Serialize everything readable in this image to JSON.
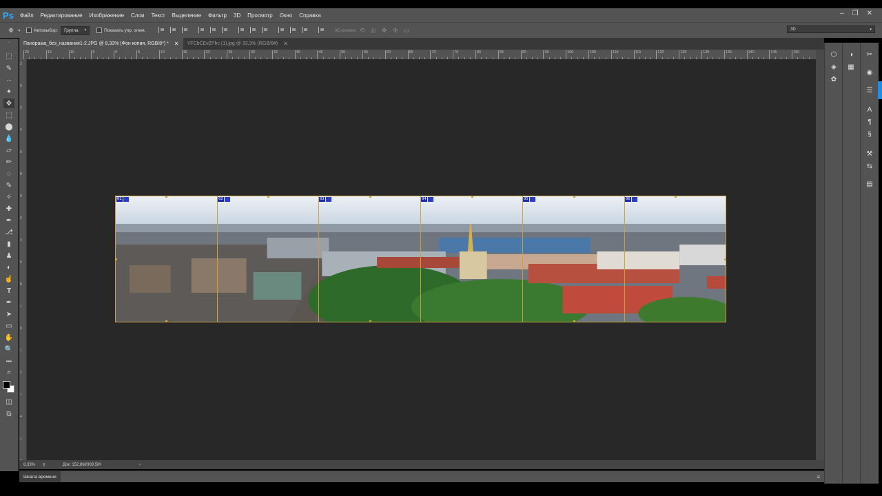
{
  "app": {
    "logo": "Ps"
  },
  "menu": [
    "Файл",
    "Редактирование",
    "Изображение",
    "Слои",
    "Текст",
    "Выделение",
    "Фильтр",
    "3D",
    "Просмотр",
    "Окно",
    "Справка"
  ],
  "window_controls": {
    "minimize": "–",
    "restore": "❐",
    "close": "✕"
  },
  "options": {
    "autoselect_label": "Автовыбор:",
    "autoselect_value": "Группа",
    "show_controls_label": "Показать упр. элем.",
    "mode_3d_label": "3D-режим:",
    "workspace_value": "3D"
  },
  "tabs": [
    {
      "title": "Панорама_без_названия1-2.JPG @ 8,33% (Фон копия, RGB/8*) *",
      "close": "✕"
    },
    {
      "title": "YFCbCEvZPhc (1).jpg @ 33,3% (RGB/8#)",
      "close": "✕"
    }
  ],
  "ruler_top": [
    "20",
    "15",
    "10",
    "5",
    "0",
    "5",
    "10",
    "15",
    "20",
    "25",
    "30",
    "35",
    "40",
    "45",
    "50",
    "55",
    "60",
    "65",
    "70",
    "75",
    "80",
    "85",
    "90",
    "95",
    "100",
    "105",
    "110",
    "115",
    "120",
    "125",
    "130",
    "135",
    "140",
    "145",
    "150"
  ],
  "ruler_left": [
    "2",
    "0",
    "2",
    "4",
    "6",
    "8",
    "0",
    "2",
    "4",
    "6",
    "8",
    "1",
    "0",
    "1",
    "2",
    "1",
    "4",
    "1",
    "6"
  ],
  "slices": [
    {
      "num": "01"
    },
    {
      "num": "02"
    },
    {
      "num": "03"
    },
    {
      "num": "04"
    },
    {
      "num": "05"
    },
    {
      "num": "06"
    }
  ],
  "status": {
    "zoom": "8,33%",
    "doc": "Док: 152,8M/309,5M",
    "arrow": "›"
  },
  "timeline": {
    "label": "Шкала времени"
  },
  "colors": {
    "accent": "#31a8ff",
    "slice_line": "#c9a23a",
    "slice_badge": "#1c2ca8",
    "canvas_bg": "#282828"
  }
}
